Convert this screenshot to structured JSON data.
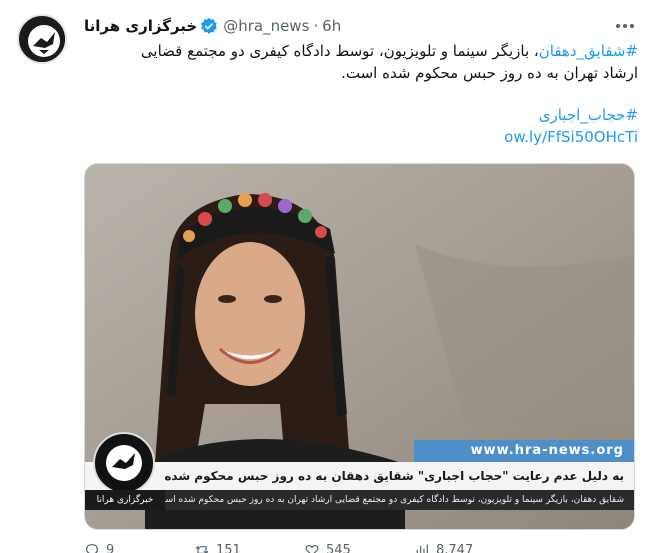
{
  "tweet": {
    "display_name": "خبرگزاری هرانا",
    "handle": "@hra_news",
    "separator": "·",
    "time": "6h",
    "text_line1_hashtag": "#شقایق_دهقان",
    "text_line1_rest": "، بازیگر سینما و تلویزیون، توسط دادگاه کیفری دو مجتمع قضایی",
    "text_line2": "ارشاد تهران به ده روز حبس محکوم شده است.",
    "hashtag2": "#حجاب_اجباری",
    "short_link": "ow.ly/FfSi50OHcTi"
  },
  "media": {
    "site_url": "www.hra-news.org",
    "headline": "به دلیل عدم رعایت \"حجاب اجباری\" شقایق دهقان به ده روز حبس محکوم شده",
    "subline": "شقایق دهقان، بازیگر سینما و تلویزیون، توسط دادگاه کیفری دو مجتمع قضایی ارشاد تهران به ده روز حبس محکوم شده است",
    "logo_caption": "خبرگزاری هرانا"
  },
  "actions": {
    "replies": "9",
    "retweets": "151",
    "likes": "545",
    "views": "8,747"
  },
  "colors": {
    "link": "#1d9bf0",
    "secondary_text": "#536471",
    "verified": "#1d9bf0",
    "banner_blue": "#4e8fc9"
  },
  "icons": [
    "verified-badge-icon",
    "more-icon",
    "reply-icon",
    "retweet-icon",
    "like-icon",
    "views-icon"
  ]
}
